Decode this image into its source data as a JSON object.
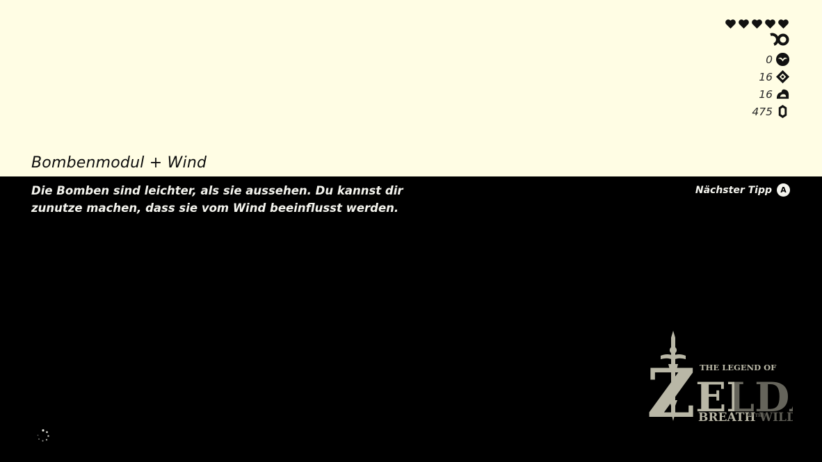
{
  "tip": {
    "title": "Bombenmodul + Wind",
    "description_lines": [
      "Die Bomben sind leichter, als sie aussehen. Du kannst dir",
      "zunutze machen, dass sie vom Wind beeinflusst werden."
    ],
    "next_tip_label": "Nächster Tipp",
    "next_tip_button": "A"
  },
  "hud": {
    "hearts": 5,
    "resources": [
      {
        "icon": "korok-seed-icon",
        "value": "0"
      },
      {
        "icon": "spirit-orb-icon",
        "value": "16"
      },
      {
        "icon": "gift-of-guidance-icon",
        "value": "16"
      },
      {
        "icon": "rupee-icon",
        "value": "475"
      }
    ]
  },
  "logo": {
    "line1": "THE LEGEND OF",
    "main": "ZELDA",
    "line2_a": "BREATH",
    "line2_b": "OF THE",
    "line2_c": "WILD"
  },
  "colors": {
    "top_background": "#fffde4",
    "bottom_background": "#000000",
    "logo": "#b9b7a6"
  }
}
